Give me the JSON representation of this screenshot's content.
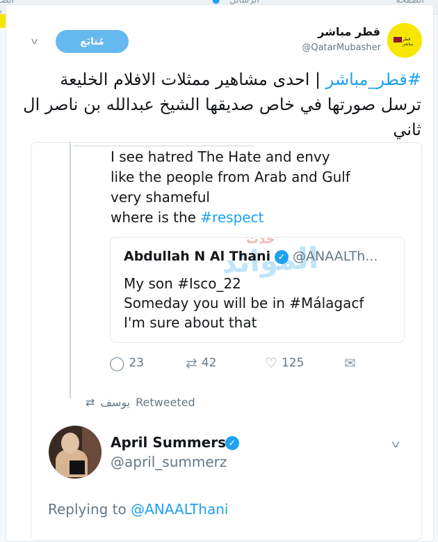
{
  "top_strip": {
    "left_text": "اتصل بنا",
    "mid_text": "الرسائل",
    "mid_icon_text": "●",
    "right_text": "الصفحة"
  },
  "header": {
    "display_name": "قطر مباشر",
    "handle": "@QatarMubasher",
    "avatar_logo_text": "قطر مباشر",
    "follow_button": "مُتابَع"
  },
  "tweet": {
    "hashtag": "#قطر_مباشر",
    "text": " | احدى مشاهير ممثلات الافلام الخليعة ترسل صورتها في خاص صديقها الشيخ عبدالله بن ناصر ال ثاني"
  },
  "embedded": {
    "lines": [
      "I see hatred The Hate and envy",
      "like the people from Arab and Gulf",
      "very shameful",
      "where is the "
    ],
    "hashtag": "#respect",
    "quote": {
      "name": "Abdullah N Al Thani",
      "handle": "@ANAALTh...",
      "lines": [
        "My son #Isco_22",
        "Someday you will be in #Málagacf",
        "I'm sure about that"
      ],
      "watermark": "الموائد"
    },
    "actions": {
      "replies": "23",
      "retweets": "42",
      "likes": "125"
    },
    "retweeted_by": "يوسف",
    "retweeted_label": "Retweeted",
    "reply": {
      "name": "April Summers",
      "handle": "@april_summerz",
      "replying_to_label": "Replying to ",
      "replying_to_handle": "@ANAALThani"
    }
  },
  "colors": {
    "link": "#1da1f2",
    "follow_button": "#66b8f0",
    "avatar_bg": "#f7e600"
  }
}
